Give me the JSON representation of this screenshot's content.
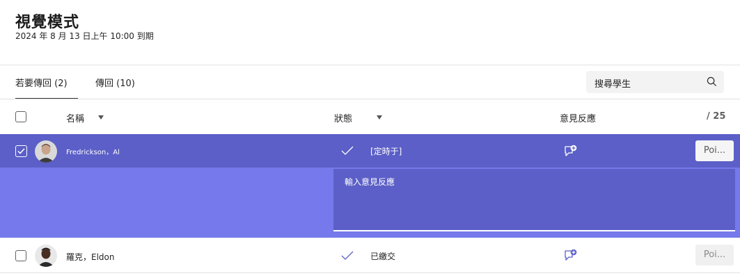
{
  "header": {
    "title": "視覺模式",
    "due": "2024 年 8 月 13 日上午 10:00 到期"
  },
  "tabs": [
    {
      "label": "若要傳回 (2)"
    },
    {
      "label": "傳回 (10)"
    }
  ],
  "search": {
    "placeholder": "搜尋學生"
  },
  "columns": {
    "name": "名稱",
    "status": "狀態",
    "feedback": "意見反應",
    "points": "/ 25"
  },
  "rows": [
    {
      "name": "Fredrickson，Al",
      "status": "[定時于]",
      "points_placeholder": "Poi...",
      "selected": true
    },
    {
      "name": "羅克，Eldon",
      "status": "已繳交",
      "points_placeholder": "Poi...",
      "selected": false
    }
  ],
  "feedback_editor": {
    "placeholder": "輸入意見反應"
  },
  "colors": {
    "accent": "#5b5fc7",
    "accent_light": "#7579eb"
  }
}
